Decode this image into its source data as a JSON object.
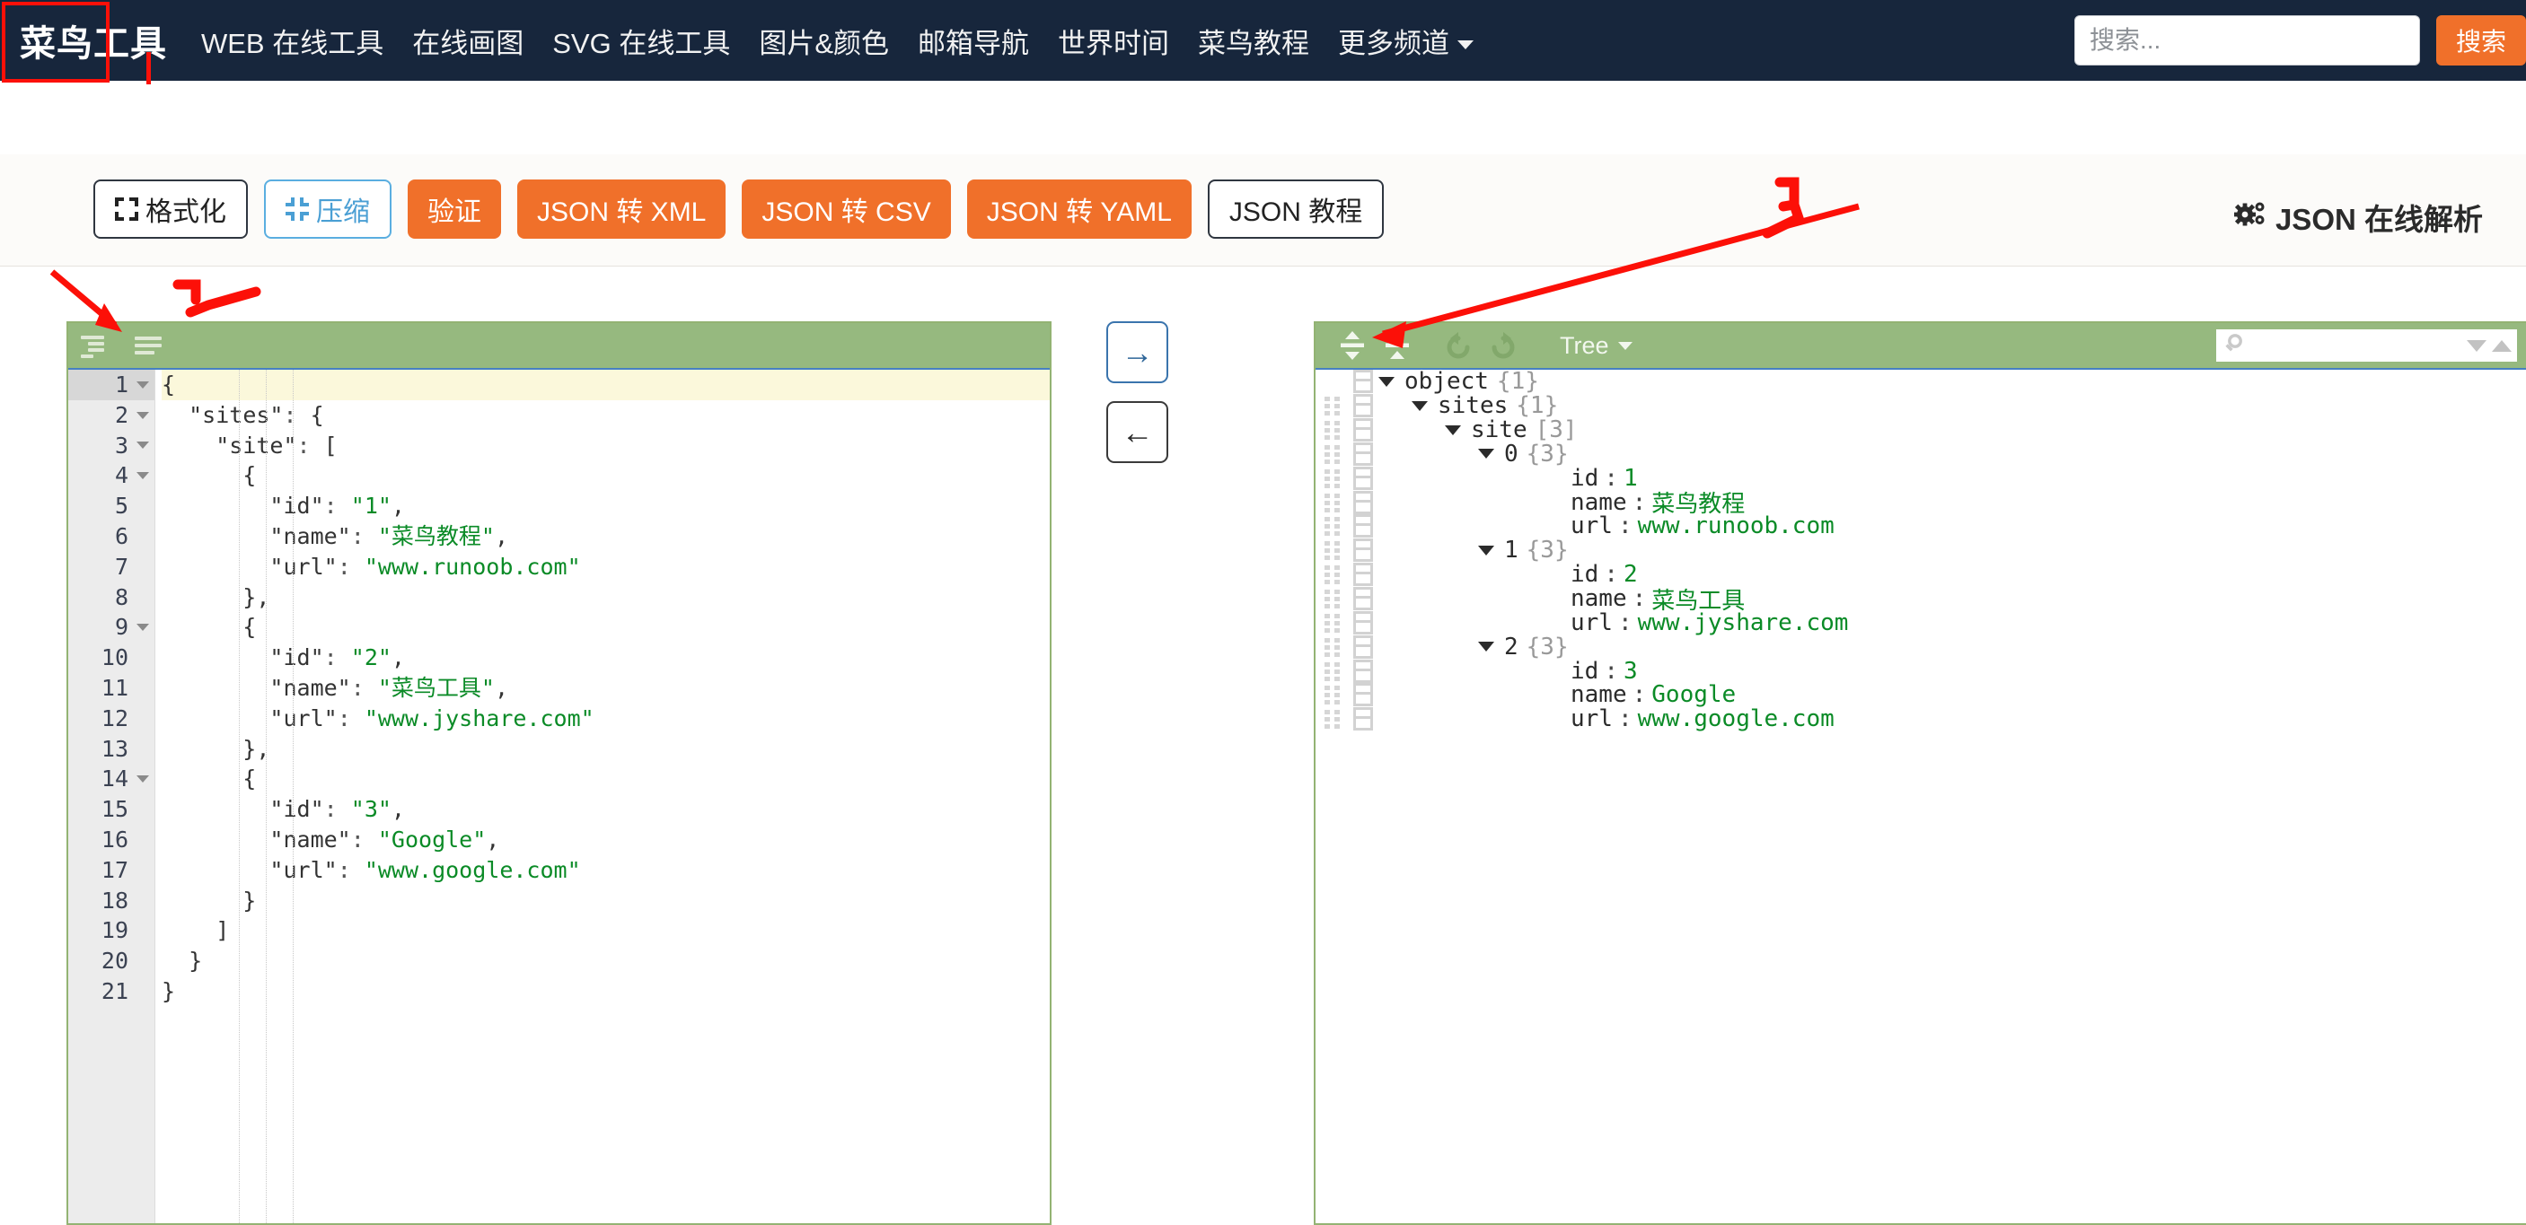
{
  "navbar": {
    "logo": "菜鸟工具",
    "links": [
      "WEB 在线工具",
      "在线画图",
      "SVG 在线工具",
      "图片&颜色",
      "邮箱导航",
      "世界时间",
      "菜鸟教程"
    ],
    "more_label": "更多频道",
    "search_placeholder": "搜索...",
    "search_value": "",
    "search_button": "搜索"
  },
  "toolbar": {
    "buttons": [
      {
        "label": "格式化",
        "style": "outline-dark",
        "icon": "expand-icon"
      },
      {
        "label": "压缩",
        "style": "outline-blue",
        "icon": "compress-icon"
      },
      {
        "label": "验证",
        "style": "orange",
        "icon": ""
      },
      {
        "label": "JSON 转 XML",
        "style": "orange",
        "icon": ""
      },
      {
        "label": "JSON 转 CSV",
        "style": "orange",
        "icon": ""
      },
      {
        "label": "JSON 转 YAML",
        "style": "orange",
        "icon": ""
      },
      {
        "label": "JSON 教程",
        "style": "plain",
        "icon": ""
      }
    ],
    "page_title": "JSON 在线解析",
    "page_title_icon": "gears-icon"
  },
  "editor": {
    "menu_icons": [
      "format-lines-icon",
      "menu-lines-icon"
    ],
    "active_line": 1,
    "lines": [
      {
        "n": 1,
        "foldable": true,
        "text": "{"
      },
      {
        "n": 2,
        "foldable": true,
        "text": "  \"sites\": {"
      },
      {
        "n": 3,
        "foldable": true,
        "text": "    \"site\": ["
      },
      {
        "n": 4,
        "foldable": true,
        "text": "      {"
      },
      {
        "n": 5,
        "foldable": false,
        "text": "        \"id\": \"1\","
      },
      {
        "n": 6,
        "foldable": false,
        "text": "        \"name\": \"菜鸟教程\","
      },
      {
        "n": 7,
        "foldable": false,
        "text": "        \"url\": \"www.runoob.com\""
      },
      {
        "n": 8,
        "foldable": false,
        "text": "      },"
      },
      {
        "n": 9,
        "foldable": true,
        "text": "      {"
      },
      {
        "n": 10,
        "foldable": false,
        "text": "        \"id\": \"2\","
      },
      {
        "n": 11,
        "foldable": false,
        "text": "        \"name\": \"菜鸟工具\","
      },
      {
        "n": 12,
        "foldable": false,
        "text": "        \"url\": \"www.jyshare.com\""
      },
      {
        "n": 13,
        "foldable": false,
        "text": "      },"
      },
      {
        "n": 14,
        "foldable": true,
        "text": "      {"
      },
      {
        "n": 15,
        "foldable": false,
        "text": "        \"id\": \"3\","
      },
      {
        "n": 16,
        "foldable": false,
        "text": "        \"name\": \"Google\","
      },
      {
        "n": 17,
        "foldable": false,
        "text": "        \"url\": \"www.google.com\""
      },
      {
        "n": 18,
        "foldable": false,
        "text": "      }"
      },
      {
        "n": 19,
        "foldable": false,
        "text": "    ]"
      },
      {
        "n": 20,
        "foldable": false,
        "text": "  }"
      },
      {
        "n": 21,
        "foldable": false,
        "text": "}"
      }
    ]
  },
  "transfer": {
    "to_right_label": "→",
    "to_left_label": "←"
  },
  "tree": {
    "mode_label": "Tree",
    "search_placeholder": "",
    "search_value": "",
    "icons": [
      "expand-all-icon",
      "collapse-all-icon",
      "undo-icon",
      "redo-icon",
      "search-icon",
      "next-result-icon",
      "prev-result-icon"
    ],
    "rows": [
      {
        "indent": 0,
        "caret": true,
        "drag": false,
        "field": "object",
        "meta": "{1}",
        "sep": "",
        "value": "",
        "vtype": ""
      },
      {
        "indent": 1,
        "caret": true,
        "drag": true,
        "field": "sites",
        "meta": "{1}",
        "sep": "",
        "value": "",
        "vtype": ""
      },
      {
        "indent": 2,
        "caret": true,
        "drag": true,
        "field": "site",
        "meta": "[3]",
        "sep": "",
        "value": "",
        "vtype": ""
      },
      {
        "indent": 3,
        "caret": true,
        "drag": true,
        "field": "0",
        "meta": "{3}",
        "sep": "",
        "value": "",
        "vtype": ""
      },
      {
        "indent": 5,
        "caret": false,
        "drag": true,
        "field": "id",
        "meta": "",
        "sep": ":",
        "value": "1",
        "vtype": "num"
      },
      {
        "indent": 5,
        "caret": false,
        "drag": true,
        "field": "name",
        "meta": "",
        "sep": ":",
        "value": "菜鸟教程",
        "vtype": "str"
      },
      {
        "indent": 5,
        "caret": false,
        "drag": true,
        "field": "url",
        "meta": "",
        "sep": ":",
        "value": "www.runoob.com",
        "vtype": "str"
      },
      {
        "indent": 3,
        "caret": true,
        "drag": true,
        "field": "1",
        "meta": "{3}",
        "sep": "",
        "value": "",
        "vtype": ""
      },
      {
        "indent": 5,
        "caret": false,
        "drag": true,
        "field": "id",
        "meta": "",
        "sep": ":",
        "value": "2",
        "vtype": "num"
      },
      {
        "indent": 5,
        "caret": false,
        "drag": true,
        "field": "name",
        "meta": "",
        "sep": ":",
        "value": "菜鸟工具",
        "vtype": "str"
      },
      {
        "indent": 5,
        "caret": false,
        "drag": true,
        "field": "url",
        "meta": "",
        "sep": ":",
        "value": "www.jyshare.com",
        "vtype": "str"
      },
      {
        "indent": 3,
        "caret": true,
        "drag": true,
        "field": "2",
        "meta": "{3}",
        "sep": "",
        "value": "",
        "vtype": ""
      },
      {
        "indent": 5,
        "caret": false,
        "drag": true,
        "field": "id",
        "meta": "",
        "sep": ":",
        "value": "3",
        "vtype": "num"
      },
      {
        "indent": 5,
        "caret": false,
        "drag": true,
        "field": "name",
        "meta": "",
        "sep": ":",
        "value": "Google",
        "vtype": "str"
      },
      {
        "indent": 5,
        "caret": false,
        "drag": true,
        "field": "url",
        "meta": "",
        "sep": ":",
        "value": "www.google.com",
        "vtype": "str"
      }
    ]
  },
  "annotations": [
    {
      "kind": "box",
      "label": ""
    },
    {
      "kind": "mark",
      "label": "1"
    },
    {
      "kind": "mark",
      "label": "2"
    },
    {
      "kind": "mark",
      "label": "3"
    }
  ],
  "colors": {
    "navbar_bg": "#17263c",
    "accent_orange": "#f0702a",
    "panel_green": "#96b97f",
    "string_green": "#0b8b27",
    "annotation_red": "#fc1008"
  }
}
